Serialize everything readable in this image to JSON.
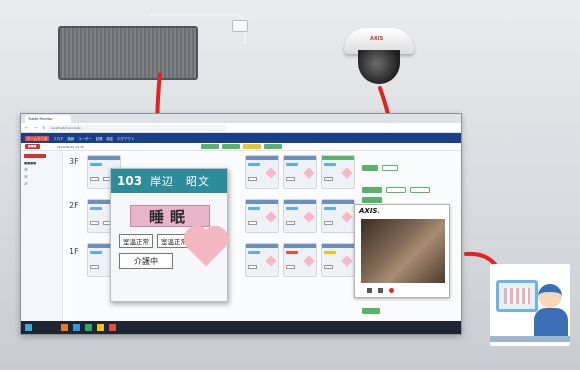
{
  "browser": {
    "tab_label": "Tablet Monitor",
    "url": "localhost/monomili/...",
    "brand": "monomili"
  },
  "app": {
    "menu": [
      "ホームモニタ",
      "フロア",
      "施設",
      "ユーザー",
      "記録",
      "設定",
      "ログアウト"
    ],
    "alert": "■■■",
    "subbar_text": "2019/06/25 14:30",
    "sidebar_items": [
      "■■■■",
      "3F",
      "2F",
      "1F"
    ],
    "floors": [
      "3F",
      "2F",
      "1F"
    ]
  },
  "popup": {
    "room_number": "103",
    "resident_name": "岸辺　昭文",
    "status": "睡眠",
    "vitals": [
      "室温正常",
      "室温正常"
    ],
    "care_status": "介護中"
  },
  "camera_view": {
    "brand_prefix": "AXIS",
    "brand_suffix": ""
  },
  "colors": {
    "header_blue": "#173f8a",
    "popup_header": "#2d8c9a",
    "status_pink": "#e8b4c8",
    "alert_red": "#d63031",
    "arrow_red": "#e02424"
  }
}
